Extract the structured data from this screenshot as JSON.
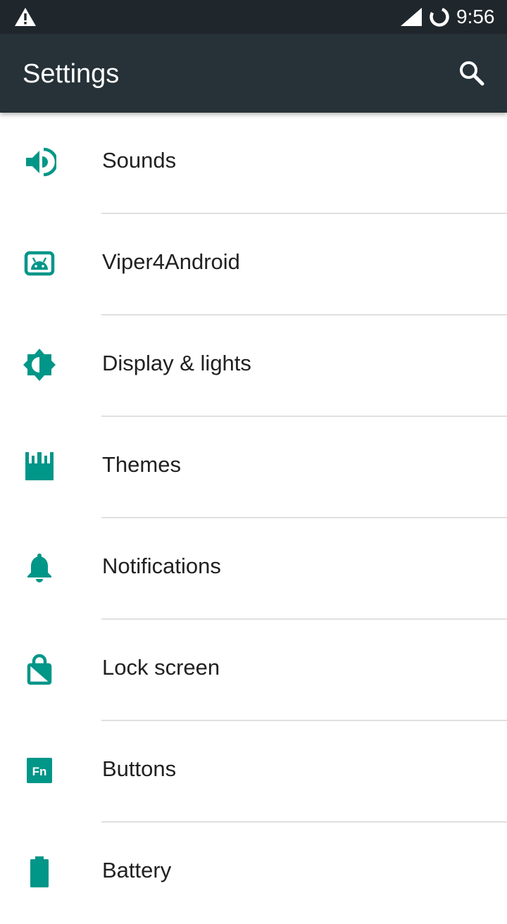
{
  "status_bar": {
    "time": "9:56",
    "icons": [
      "warning-icon",
      "cell-signal-icon",
      "sync-ring-icon"
    ]
  },
  "app_bar": {
    "title": "Settings",
    "search_icon": "search-icon"
  },
  "accent_color": "#009688",
  "app_bar_color": "#263238",
  "status_bar_color": "#20272c",
  "settings_items": [
    {
      "label": "Sounds",
      "icon": "speaker-icon"
    },
    {
      "label": "Viper4Android",
      "icon": "android-icon"
    },
    {
      "label": "Display & lights",
      "icon": "brightness-icon"
    },
    {
      "label": "Themes",
      "icon": "themes-icon"
    },
    {
      "label": "Notifications",
      "icon": "bell-icon"
    },
    {
      "label": "Lock screen",
      "icon": "lock-screen-icon"
    },
    {
      "label": "Buttons",
      "icon": "fn-buttons-icon",
      "icon_text": "Fn"
    },
    {
      "label": "Battery",
      "icon": "battery-icon"
    }
  ]
}
